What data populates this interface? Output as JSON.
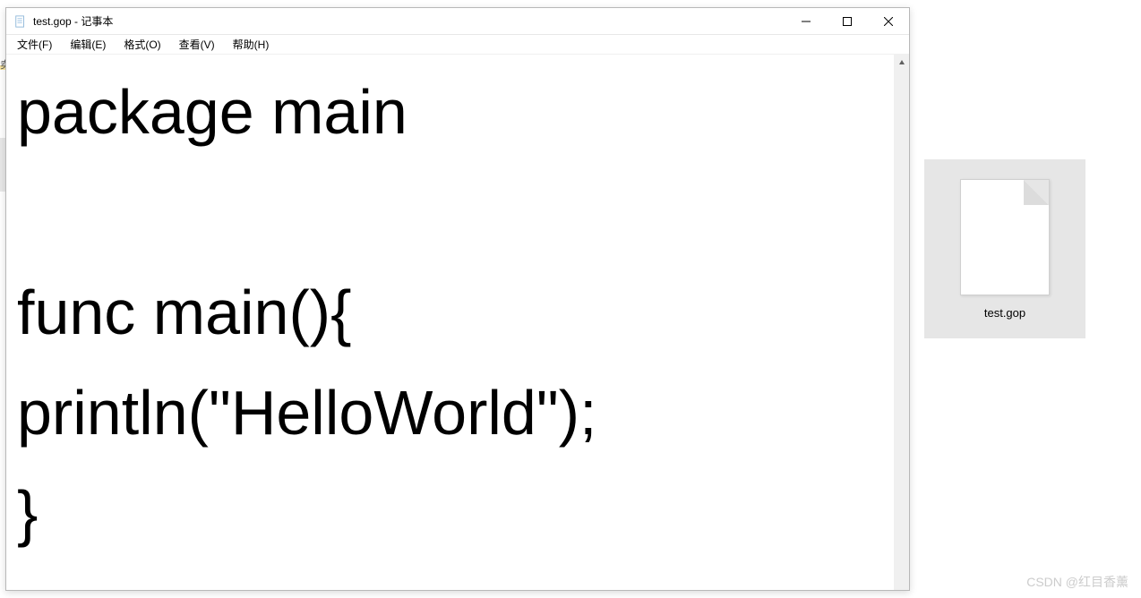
{
  "window": {
    "title": "test.gop - 记事本"
  },
  "menu": {
    "file": "文件(F)",
    "edit": "编辑(E)",
    "format": "格式(O)",
    "view": "查看(V)",
    "help": "帮助(H)"
  },
  "editor": {
    "content": "package main\n\nfunc main(){\nprintln(\"HelloWorld\");\n}"
  },
  "desktop": {
    "file_name": "test.gop"
  },
  "watermark": "CSDN @红目香薰",
  "left_fragment": "卖"
}
